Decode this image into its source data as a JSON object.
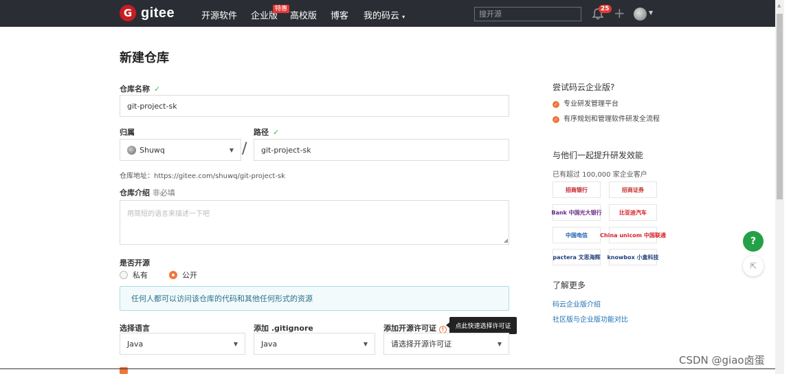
{
  "nav": {
    "logo_letter": "G",
    "logo_text": "gitee",
    "links": [
      "开源软件",
      "企业版",
      "高校版",
      "博客",
      "我的码云"
    ],
    "badge": "特惠",
    "search_placeholder": "搜开源",
    "notif_count": "25",
    "plus": "+"
  },
  "form": {
    "title": "新建仓库",
    "repo_name_label": "仓库名称",
    "repo_name_value": "git-project-sk",
    "owner_label": "归属",
    "owner_value": "Shuwq",
    "path_label": "路径",
    "path_value": "git-project-sk",
    "slash": "/",
    "address": "仓库地址：https://gitee.com/shuwq/git-project-sk",
    "intro_label": "仓库介绍",
    "intro_optional": "非必填",
    "intro_placeholder": "用简短的语言来描述一下吧",
    "open_label": "是否开源",
    "private_label": "私有",
    "public_label": "公开",
    "notice": "任何人都可以访问该仓库的代码和其他任何形式的资源",
    "language_label": "选择语言",
    "language_value": "Java",
    "gitignore_label": "添加 .gitignore",
    "gitignore_value": "Java",
    "license_label": "添加开源许可证",
    "license_placeholder": "请选择开源许可证",
    "tooltip": "点此快速选择许可证"
  },
  "sidebar": {
    "try_title": "尝试码云企业版?",
    "features": [
      "专业研发管理平台",
      "有序规划和管理软件研发全流程"
    ],
    "efficiency_title": "与他们一起提升研发效能",
    "customers": "已有超过 100,000 家企业客户",
    "logos": [
      "招商银行",
      "招商证券",
      "Bank 中国光大银行",
      "比亚迪汽车",
      "中国电信",
      "China unicom 中国联通",
      "pactera 文思海辉",
      "knowbox 小盒科技"
    ],
    "learn_more": "了解更多",
    "links": [
      "码云企业版介绍",
      "社区版与企业版功能对比"
    ]
  },
  "fab": {
    "help": "?"
  },
  "watermark": "CSDN @giao卤蛋",
  "colors": {
    "nav_bg": "#2b2d34",
    "brand": "#c71d23",
    "accent": "#f0743b",
    "link": "#1a6fb5",
    "help": "#24a148"
  }
}
